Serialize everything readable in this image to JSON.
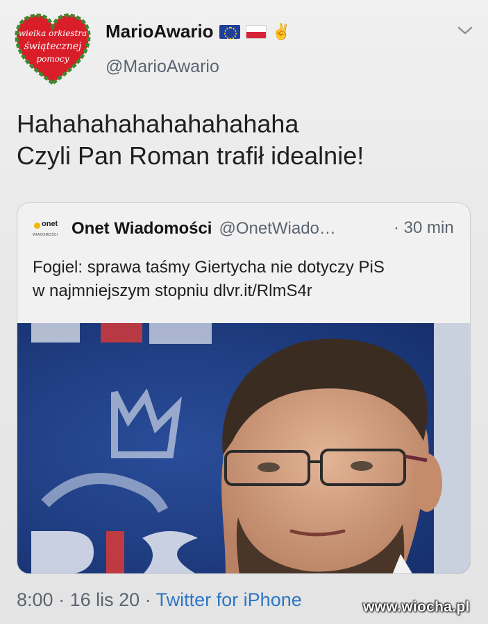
{
  "author": {
    "display_name": "MarioAwario",
    "handle": "@MarioAwario",
    "avatar_text": [
      "wielka orkiestra",
      "świątecznej",
      "pomocy"
    ],
    "emoji": [
      "eu-flag-icon",
      "poland-flag-icon",
      "victory-hand-icon"
    ]
  },
  "tweet": {
    "lines": [
      "Hahahahahahahahahaha",
      "Czyli Pan Roman trafił idealnie!"
    ]
  },
  "quoted": {
    "logo_word": "onet",
    "logo_sub": "WIADOMOŚCI",
    "source_name": "Onet Wiadomości",
    "source_handle": "@OnetWiado…",
    "time": "· 30 min",
    "text_lines": [
      "Fogiel: sprawa taśmy Giertycha nie dotyczy PiS",
      "w najmniejszym stopniu dlvr.it/RlmS4r"
    ]
  },
  "meta": {
    "time": "8:00",
    "sep1": " · ",
    "date": "16 lis 20",
    "sep2": " · ",
    "client": "Twitter for iPhone"
  },
  "watermark": "www.wiocha.pl",
  "colors": {
    "link": "#2e76c6",
    "muted": "#5b6570",
    "avatar_heart": "#d91e2a",
    "photo_bg": "#1f3f86"
  }
}
